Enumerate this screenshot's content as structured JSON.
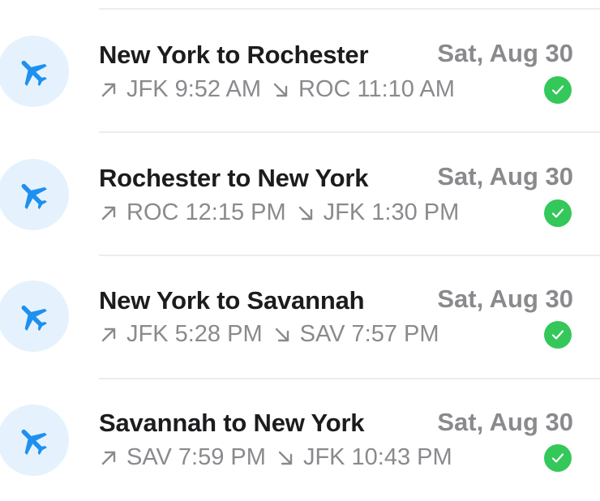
{
  "colors": {
    "accent": "#1e90f0",
    "avatar_bg": "#e5f2fd",
    "success": "#34c759"
  },
  "flights": [
    {
      "title": "New York to Rochester",
      "date": "Sat, Aug 30",
      "depart": "JFK 9:52 AM",
      "arrive": "ROC 11:10 AM",
      "status_icon": "check-circle-icon"
    },
    {
      "title": "Rochester to New York",
      "date": "Sat, Aug 30",
      "depart": "ROC 12:15 PM",
      "arrive": "JFK 1:30 PM",
      "status_icon": "check-circle-icon"
    },
    {
      "title": "New York to Savannah",
      "date": "Sat, Aug 30",
      "depart": "JFK 5:28 PM",
      "arrive": "SAV 7:57 PM",
      "status_icon": "check-circle-icon"
    },
    {
      "title": "Savannah to New York",
      "date": "Sat, Aug 30",
      "depart": "SAV 7:59 PM",
      "arrive": "JFK 10:43 PM",
      "status_icon": "check-circle-icon"
    }
  ]
}
